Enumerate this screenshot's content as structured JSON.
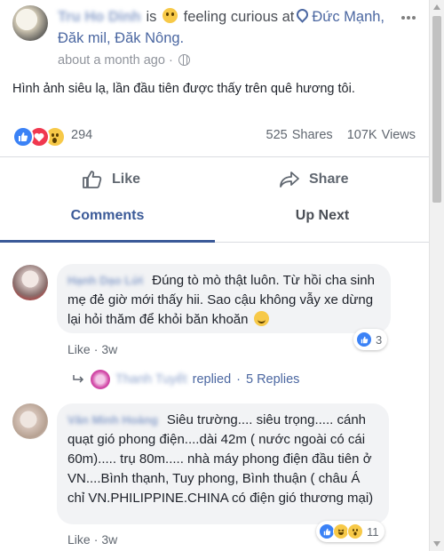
{
  "post": {
    "author_name": "Tru Ho Dinh",
    "feeling_prefix": "is",
    "feeling": "feeling curious at",
    "location": "Đức Mạnh, Đăk mil, Đăk Nông.",
    "time": "about a month ago",
    "text": "Hình ảnh siêu lạ, lần đầu tiên được thấy trên quê hương tôi.",
    "reaction_count": "294",
    "shares": "525 Shares",
    "views": "107K Views"
  },
  "actions": {
    "like": "Like",
    "share": "Share"
  },
  "tabs": {
    "comments": "Comments",
    "up_next": "Up Next"
  },
  "comments": [
    {
      "name": "Hạnh Dạo Lửi",
      "text": "Đúng tò mò thật luôn. Từ hồi cha sinh mẹ đẻ giờ mới thấy hii. Sao cậu không vẫy xe dừng lại hỏi thăm để khỏi băn khoăn",
      "like_label": "Like",
      "time": "3w",
      "reactions": "3",
      "reply_name": "Thanh Tuyết",
      "reply_action": "replied",
      "reply_dot": "·",
      "reply_count": "5 Replies"
    },
    {
      "name": "Văn Minh Hoàng",
      "text": "Siêu trường.... siêu trọng..... cánh quạt gió phong điện....dài 42m ( nước ngoài có cái 60m)..... trụ 80m..... nhà máy phong điện đầu tiên ở VN....Bình thạnh, Tuy phong, Bình thuận ( châu Á chỉ VN.PHILIPPINE.CHINA có điện gió thương mại)",
      "like_label": "Like",
      "time": "3w",
      "reactions": "11"
    }
  ],
  "separator": "·",
  "colors": {
    "accent": "#3b5a98",
    "link": "#4b67a1",
    "like_blue": "#3b82f6",
    "love_red": "#f0384f",
    "wow_yellow": "#f7c948"
  }
}
